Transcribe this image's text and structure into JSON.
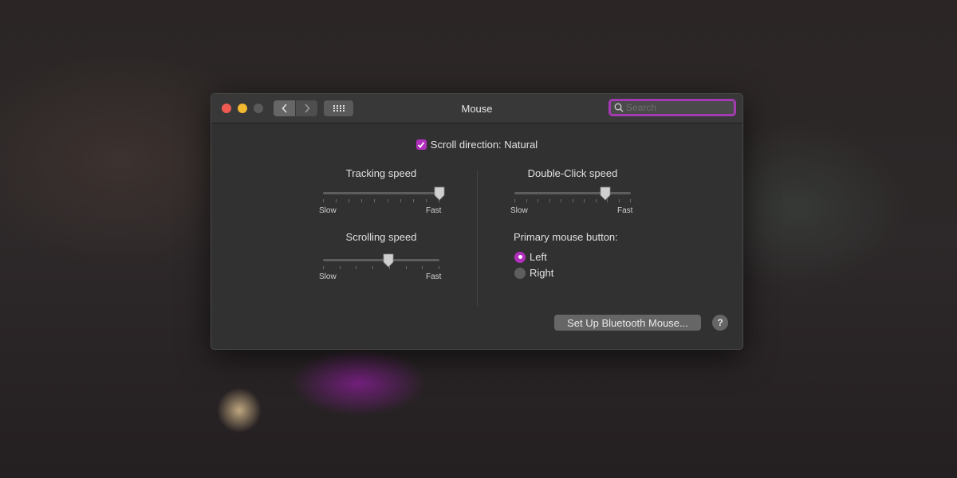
{
  "window": {
    "title": "Mouse",
    "search": {
      "placeholder": "Search",
      "value": ""
    }
  },
  "colors": {
    "accent": "#b12fbd",
    "window_bg": "#313131",
    "titlebar_bg": "#383838"
  },
  "icons": {
    "back": "chevron-left-icon",
    "forward": "chevron-right-icon",
    "show_all": "grid-icon",
    "search": "search-icon",
    "help": "help-icon"
  },
  "scroll_direction": {
    "label": "Scroll direction: Natural",
    "checked": true
  },
  "tracking_speed": {
    "label": "Tracking speed",
    "min_label": "Slow",
    "max_label": "Fast",
    "value": 1.0,
    "ticks": 10
  },
  "scrolling_speed": {
    "label": "Scrolling speed",
    "min_label": "Slow",
    "max_label": "Fast",
    "value": 0.56,
    "ticks": 8
  },
  "double_click_speed": {
    "label": "Double-Click speed",
    "min_label": "Slow",
    "max_label": "Fast",
    "value": 0.78,
    "ticks": 11
  },
  "primary_button": {
    "label": "Primary mouse button:",
    "options": [
      {
        "label": "Left",
        "selected": true
      },
      {
        "label": "Right",
        "selected": false
      }
    ]
  },
  "bluetooth_button": {
    "label": "Set Up Bluetooth Mouse..."
  },
  "help": {
    "label": "?"
  }
}
